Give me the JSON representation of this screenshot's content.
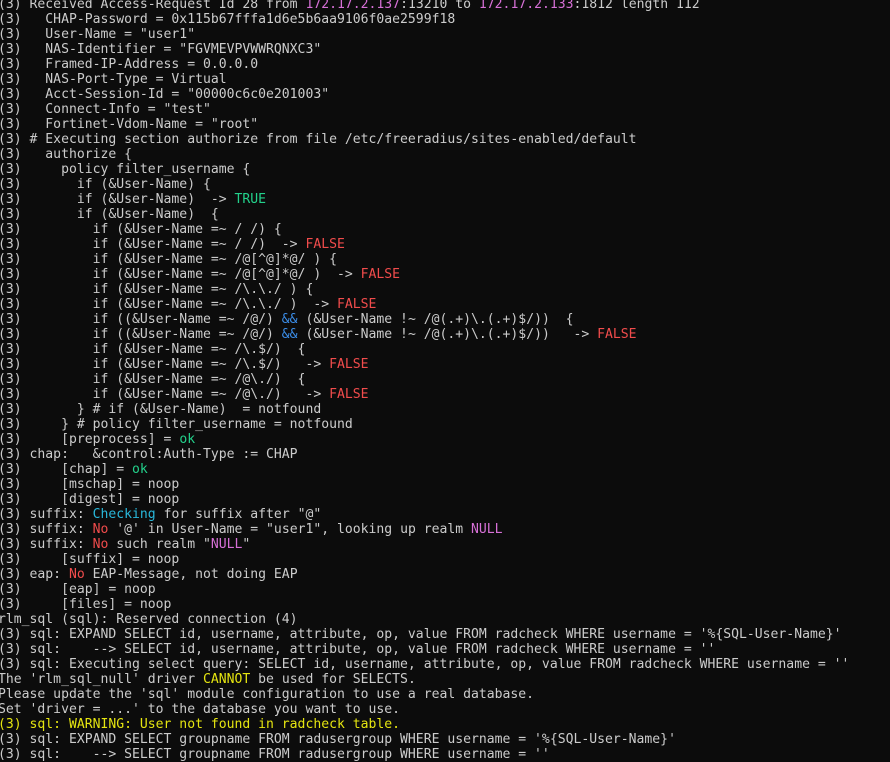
{
  "colors": {
    "default": "#cccccc",
    "background": "#0c0c0c",
    "magenta": "#d670d6",
    "green": "#23d18b",
    "red": "#f14c4c",
    "blue": "#3b8eea",
    "cyan": "#29b8db",
    "yellow": "#e5e510"
  },
  "lines": [
    [
      [
        "(3) Received Access-Request Id 28 from ",
        ""
      ],
      [
        "172.17.2.137",
        "magenta"
      ],
      [
        ":13210 to ",
        ""
      ],
      [
        "172.17.2.133",
        "magenta"
      ],
      [
        ":1812 length 112",
        ""
      ]
    ],
    [
      [
        "(3)   CHAP-Password = 0x115b67fffa1d6e5b6aa9106f0ae2599f18",
        ""
      ]
    ],
    [
      [
        "(3)   User-Name = \"user1\"",
        ""
      ]
    ],
    [
      [
        "(3)   NAS-Identifier = \"FGVMEVPVWWRQNXC3\"",
        ""
      ]
    ],
    [
      [
        "(3)   Framed-IP-Address = 0.0.0.0",
        ""
      ]
    ],
    [
      [
        "(3)   NAS-Port-Type = Virtual",
        ""
      ]
    ],
    [
      [
        "(3)   Acct-Session-Id = \"00000c6c0e201003\"",
        ""
      ]
    ],
    [
      [
        "(3)   Connect-Info = \"test\"",
        ""
      ]
    ],
    [
      [
        "(3)   Fortinet-Vdom-Name = \"root\"",
        ""
      ]
    ],
    [
      [
        "(3) # Executing section authorize from file /etc/freeradius/sites-enabled/default",
        ""
      ]
    ],
    [
      [
        "(3)   authorize {",
        ""
      ]
    ],
    [
      [
        "(3)     policy filter_username {",
        ""
      ]
    ],
    [
      [
        "(3)       if (&User-Name) {",
        ""
      ]
    ],
    [
      [
        "(3)       if (&User-Name)  -> ",
        ""
      ],
      [
        "TRUE",
        "green"
      ]
    ],
    [
      [
        "(3)       if (&User-Name)  {",
        ""
      ]
    ],
    [
      [
        "(3)         if (&User-Name =~ / /) {",
        ""
      ]
    ],
    [
      [
        "(3)         if (&User-Name =~ / /)  -> ",
        ""
      ],
      [
        "FALSE",
        "red"
      ]
    ],
    [
      [
        "(3)         if (&User-Name =~ /@[^@]*@/ ) {",
        ""
      ]
    ],
    [
      [
        "(3)         if (&User-Name =~ /@[^@]*@/ )  -> ",
        ""
      ],
      [
        "FALSE",
        "red"
      ]
    ],
    [
      [
        "(3)         if (&User-Name =~ /\\.\\./ ) {",
        ""
      ]
    ],
    [
      [
        "(3)         if (&User-Name =~ /\\.\\./ )  -> ",
        ""
      ],
      [
        "FALSE",
        "red"
      ]
    ],
    [
      [
        "(3)         if ((&User-Name =~ /@/) ",
        ""
      ],
      [
        "&&",
        "blue"
      ],
      [
        " (&User-Name !~ /@(.+)\\.(.+)$/))  {",
        ""
      ]
    ],
    [
      [
        "(3)         if ((&User-Name =~ /@/) ",
        ""
      ],
      [
        "&&",
        "blue"
      ],
      [
        " (&User-Name !~ /@(.+)\\.(.+)$/))   -> ",
        ""
      ],
      [
        "FALSE",
        "red"
      ]
    ],
    [
      [
        "(3)         if (&User-Name =~ /\\.$/)  {",
        ""
      ]
    ],
    [
      [
        "(3)         if (&User-Name =~ /\\.$/)   -> ",
        ""
      ],
      [
        "FALSE",
        "red"
      ]
    ],
    [
      [
        "(3)         if (&User-Name =~ /@\\./)  {",
        ""
      ]
    ],
    [
      [
        "(3)         if (&User-Name =~ /@\\./)   -> ",
        ""
      ],
      [
        "FALSE",
        "red"
      ]
    ],
    [
      [
        "(3)       } # if (&User-Name)  = notfound",
        ""
      ]
    ],
    [
      [
        "(3)     } # policy filter_username = notfound",
        ""
      ]
    ],
    [
      [
        "(3)     [preprocess] = ",
        ""
      ],
      [
        "ok",
        "green"
      ]
    ],
    [
      [
        "(3) chap:   &control:Auth-Type := CHAP",
        ""
      ]
    ],
    [
      [
        "(3)     [chap] = ",
        ""
      ],
      [
        "ok",
        "green"
      ]
    ],
    [
      [
        "(3)     [mschap] = noop",
        ""
      ]
    ],
    [
      [
        "(3)     [digest] = noop",
        ""
      ]
    ],
    [
      [
        "(3) suffix: ",
        ""
      ],
      [
        "Checking",
        "cyan"
      ],
      [
        " for suffix after \"@\"",
        ""
      ]
    ],
    [
      [
        "(3) suffix: ",
        ""
      ],
      [
        "No",
        "red"
      ],
      [
        " '@' in User-Name = \"user1\", looking up realm ",
        ""
      ],
      [
        "NULL",
        "magenta"
      ]
    ],
    [
      [
        "(3) suffix: ",
        ""
      ],
      [
        "No",
        "red"
      ],
      [
        " such realm \"",
        ""
      ],
      [
        "NULL",
        "magenta"
      ],
      [
        "\"",
        ""
      ]
    ],
    [
      [
        "(3)     [suffix] = noop",
        ""
      ]
    ],
    [
      [
        "(3) eap: ",
        ""
      ],
      [
        "No",
        "red"
      ],
      [
        " EAP-Message, not doing EAP",
        ""
      ]
    ],
    [
      [
        "(3)     [eap] = noop",
        ""
      ]
    ],
    [
      [
        "(3)     [files] = noop",
        ""
      ]
    ],
    [
      [
        "rlm_sql (sql): Reserved connection (4)",
        ""
      ]
    ],
    [
      [
        "(3) sql: EXPAND SELECT id, username, attribute, op, value FROM radcheck WHERE username = '%{SQL-User-Name}'",
        ""
      ]
    ],
    [
      [
        "(3) sql:    --> SELECT id, username, attribute, op, value FROM radcheck WHERE username = ''",
        ""
      ]
    ],
    [
      [
        "(3) sql: Executing select query: SELECT id, username, attribute, op, value FROM radcheck WHERE username = ''",
        ""
      ]
    ],
    [
      [
        "The 'rlm_sql_null' driver ",
        ""
      ],
      [
        "CANNOT",
        "yellow"
      ],
      [
        " be used for SELECTS.",
        ""
      ]
    ],
    [
      [
        "Please update the 'sql' module configuration to use a real database.",
        ""
      ]
    ],
    [
      [
        "Set 'driver = ...' to the database you want to use.",
        ""
      ]
    ],
    [
      [
        "(3) sql: WARNING: User not found in radcheck table.",
        "yellow"
      ]
    ],
    [
      [
        "(3) sql: EXPAND SELECT groupname FROM radusergroup WHERE username = '%{SQL-User-Name}'",
        ""
      ]
    ],
    [
      [
        "(3) sql:    --> SELECT groupname FROM radusergroup WHERE username = ''",
        ""
      ]
    ]
  ]
}
